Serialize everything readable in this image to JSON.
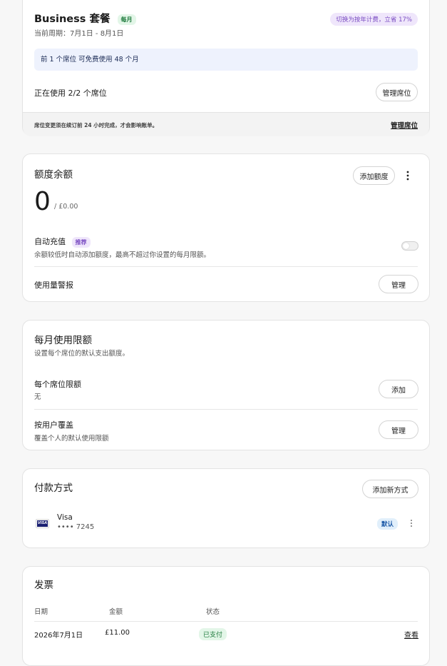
{
  "plan": {
    "name": "Business 套餐",
    "badge": "每月",
    "period": "当前周期：7月1日 - 8月1日",
    "annual_cta": "切换为按年计费，立省 17%",
    "free_seat_note": "前 1 个席位 可免费使用 48 个月",
    "seats_in_use": "正在使用 2/2 个席位",
    "manage_seats_button": "管理席位",
    "footer_note": "席位变更须在续订前 24 小时完成，才会影响账单。",
    "footer_link": "管理席位"
  },
  "credit": {
    "title": "额度余额",
    "add_button": "添加额度",
    "more_icon": "more-vertical-icon",
    "balance": "0",
    "balance_total": "/ £0.00",
    "auto_reload_title": "自动充值",
    "auto_reload_badge": "推荐",
    "auto_reload_desc": "余额较低时自动添加额度，最高不超过你设置的每月限额。",
    "auto_reload_enabled": false,
    "usage_alert_title": "使用量警报",
    "usage_alert_button": "管理"
  },
  "monthly_limit": {
    "title": "每月使用限额",
    "desc": "设置每个席位的默认支出额度。",
    "per_seat_title": "每个席位限额",
    "per_seat_value": "无",
    "per_seat_button": "添加",
    "override_title": "按用户覆盖",
    "override_desc": "覆盖个人的默认使用限额",
    "override_button": "管理"
  },
  "payment": {
    "title": "付款方式",
    "add_button": "添加新方式",
    "card_brand_logo": "VISA",
    "card_brand": "Visa",
    "card_number": "•••• 7245",
    "default_badge": "默认",
    "more_icon": "more-vertical-icon"
  },
  "invoices": {
    "title": "发票",
    "columns": [
      "日期",
      "金额",
      "状态"
    ],
    "rows": [
      {
        "date": "2026年7月1日",
        "amount": "£11.00",
        "status": "已支付",
        "action": "查看"
      }
    ]
  },
  "colors": {
    "green_badge_bg": "#e3f6e8",
    "green_badge_fg": "#1f7a3d",
    "purple_badge_bg": "#efe6fb",
    "purple_badge_fg": "#7a4cc2",
    "blue_note_bg": "#eef2fd",
    "blue_badge_bg": "#e1effb",
    "blue_badge_fg": "#1d5aa8"
  }
}
